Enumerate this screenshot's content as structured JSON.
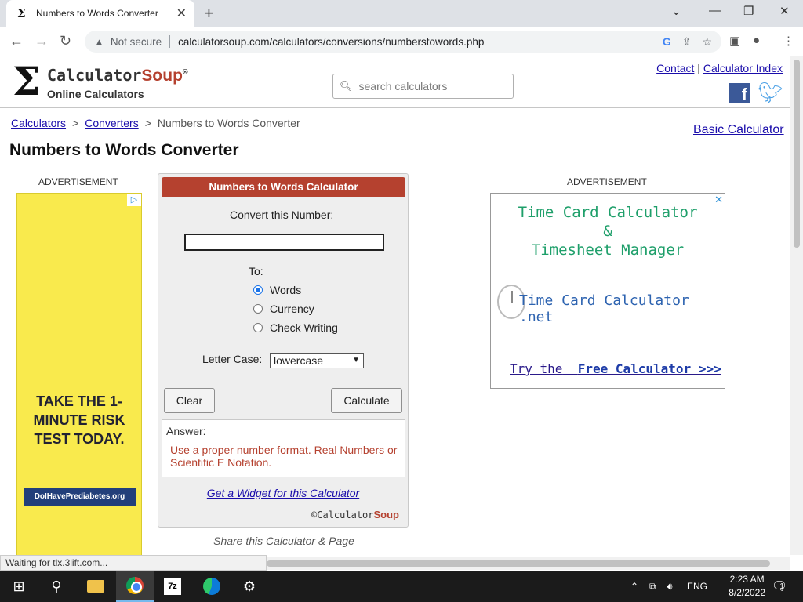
{
  "browser": {
    "tab_title": "Numbers to Words Converter",
    "tab_favicon": "Σ",
    "security_label": "Not secure",
    "url": "calculatorsoup.com/calculators/conversions/numberstowords.php"
  },
  "site": {
    "logo_text_main": "Calculator",
    "logo_text_accent": "Soup",
    "logo_mark": "®",
    "logo_subtitle": "Online Calculators",
    "search_placeholder": "search calculators",
    "top_links": [
      "Contact",
      "Calculator Index"
    ],
    "top_links_sep": "|"
  },
  "breadcrumb": {
    "items": [
      "Calculators",
      "Converters",
      "Numbers to Words Converter"
    ],
    "sep": ">"
  },
  "basic_calculator_link": "Basic Calculator",
  "page_title": "Numbers to Words Converter",
  "ads": {
    "label": "ADVERTISEMENT",
    "left_text": "TAKE THE 1-MINUTE RISK TEST TODAY.",
    "left_badge": "DoIHavePrediabetes.org",
    "right_title_line1": "Time Card Calculator",
    "right_title_line2": "&",
    "right_title_line3": "Timesheet Manager",
    "right_site": "Time Card Calculator .net",
    "right_cta_prefix": "Try the",
    "right_cta": "Free Calculator >>>"
  },
  "calculator": {
    "title": "Numbers to Words Calculator",
    "convert_label": "Convert this Number:",
    "number_value": "",
    "to_label": "To:",
    "options": [
      {
        "label": "Words",
        "selected": true
      },
      {
        "label": "Currency",
        "selected": false
      },
      {
        "label": "Check Writing",
        "selected": false
      }
    ],
    "letter_case_label": "Letter Case:",
    "letter_case_value": "lowercase",
    "clear_label": "Clear",
    "calculate_label": "Calculate",
    "answer_label": "Answer:",
    "answer_message": "Use a proper number format. Real Numbers or Scientific E Notation.",
    "widget_link": "Get a Widget for this Calculator",
    "footer_prefix": "©Calculator",
    "footer_accent": "Soup"
  },
  "share_text": "Share this Calculator & Page",
  "status_text": "Waiting for tlx.3lift.com...",
  "taskbar": {
    "language": "ENG",
    "time": "2:23 AM",
    "date": "8/2/2022",
    "notification_count": "1"
  },
  "colors": {
    "brand_red": "#b5412f",
    "link_blue": "#1a0dab",
    "ad_yellow": "#f9ea4d"
  }
}
